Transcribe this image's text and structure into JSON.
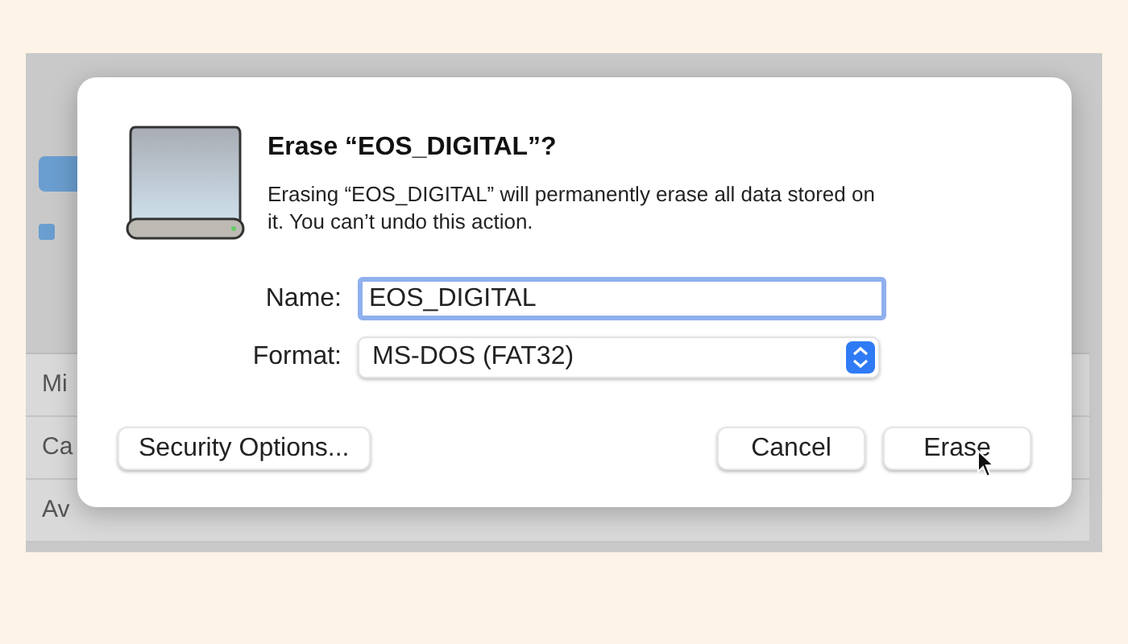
{
  "background": {
    "rows": [
      {
        "label": "Mi"
      },
      {
        "label": "Ca"
      },
      {
        "label": "Av"
      }
    ]
  },
  "dialog": {
    "title": "Erase “EOS_DIGITAL”?",
    "message": "Erasing “EOS_DIGITAL” will permanently erase all data stored on it. You can’t undo this action.",
    "fields": [
      {
        "kind": "text",
        "label": "Name:",
        "value": "EOS_DIGITAL",
        "focused": true
      },
      {
        "kind": "popup",
        "label": "Format:",
        "value": "MS-DOS (FAT32)",
        "focused": false
      }
    ],
    "buttons": [
      {
        "label": "Security Options...",
        "kind": "left"
      },
      {
        "label": "Cancel",
        "kind": "right"
      },
      {
        "label": "Erase",
        "kind": "right"
      }
    ]
  }
}
